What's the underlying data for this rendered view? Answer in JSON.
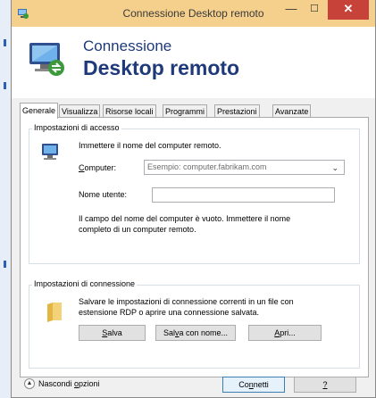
{
  "window": {
    "title": "Connessione Desktop remoto",
    "minimize_glyph": "—",
    "maximize_glyph": "☐",
    "close_glyph": "✕"
  },
  "header": {
    "line1": "Connessione",
    "line2": "Desktop remoto"
  },
  "tabs": [
    {
      "label": "Generale",
      "active": true
    },
    {
      "label": "Visualizza"
    },
    {
      "label": "Risorse locali"
    },
    {
      "label": "Programmi"
    },
    {
      "label": "Prestazioni"
    },
    {
      "label": "Avanzate"
    }
  ],
  "access": {
    "group_label": "Impostazioni di accesso",
    "instruction": "Immettere il nome del computer remoto.",
    "computer_label": "Computer:",
    "computer_placeholder": "Esempio: computer.fabrikam.com",
    "username_label": "Nome utente:",
    "username_value": "",
    "warning_line1": "Il campo del nome del computer è vuoto. Immettere il nome",
    "warning_line2": "completo di un computer remoto."
  },
  "connection": {
    "group_label": "Impostazioni di connessione",
    "desc_line1": "Salvare le impostazioni di connessione correnti in un file con",
    "desc_line2": "estensione RDP o aprire una connessione salvata.",
    "save_label": "Salva",
    "save_as_label": "Salva con nome...",
    "open_label": "Apri..."
  },
  "footer": {
    "toggle_label": "Nascondi opzioni",
    "connect_label": "Connetti",
    "help_label": "?"
  },
  "colors": {
    "titlebar": "#f5cf8c",
    "close_button": "#c7433a",
    "header_text": "#1f3a7a"
  }
}
